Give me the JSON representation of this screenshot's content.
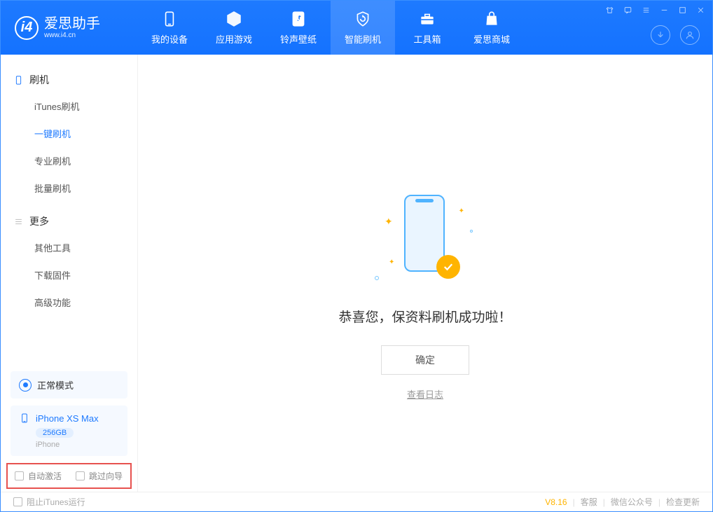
{
  "app": {
    "name": "爱思助手",
    "url": "www.i4.cn"
  },
  "nav": {
    "device": "我的设备",
    "apps": "应用游戏",
    "ring": "铃声壁纸",
    "flash": "智能刷机",
    "toolbox": "工具箱",
    "store": "爱思商城"
  },
  "sidebar": {
    "group_flash": "刷机",
    "items_flash": {
      "itunes": "iTunes刷机",
      "oneclick": "一键刷机",
      "pro": "专业刷机",
      "batch": "批量刷机"
    },
    "group_more": "更多",
    "items_more": {
      "other": "其他工具",
      "firmware": "下载固件",
      "advanced": "高级功能"
    },
    "mode": "正常模式",
    "device": {
      "name": "iPhone XS Max",
      "capacity": "256GB",
      "type": "iPhone"
    },
    "checks": {
      "auto_activate": "自动激活",
      "skip_guide": "跳过向导"
    }
  },
  "main": {
    "success": "恭喜您，保资料刷机成功啦！",
    "ok": "确定",
    "log": "查看日志"
  },
  "footer": {
    "block_itunes": "阻止iTunes运行",
    "version": "V8.16",
    "support": "客服",
    "wechat": "微信公众号",
    "update": "检查更新"
  }
}
